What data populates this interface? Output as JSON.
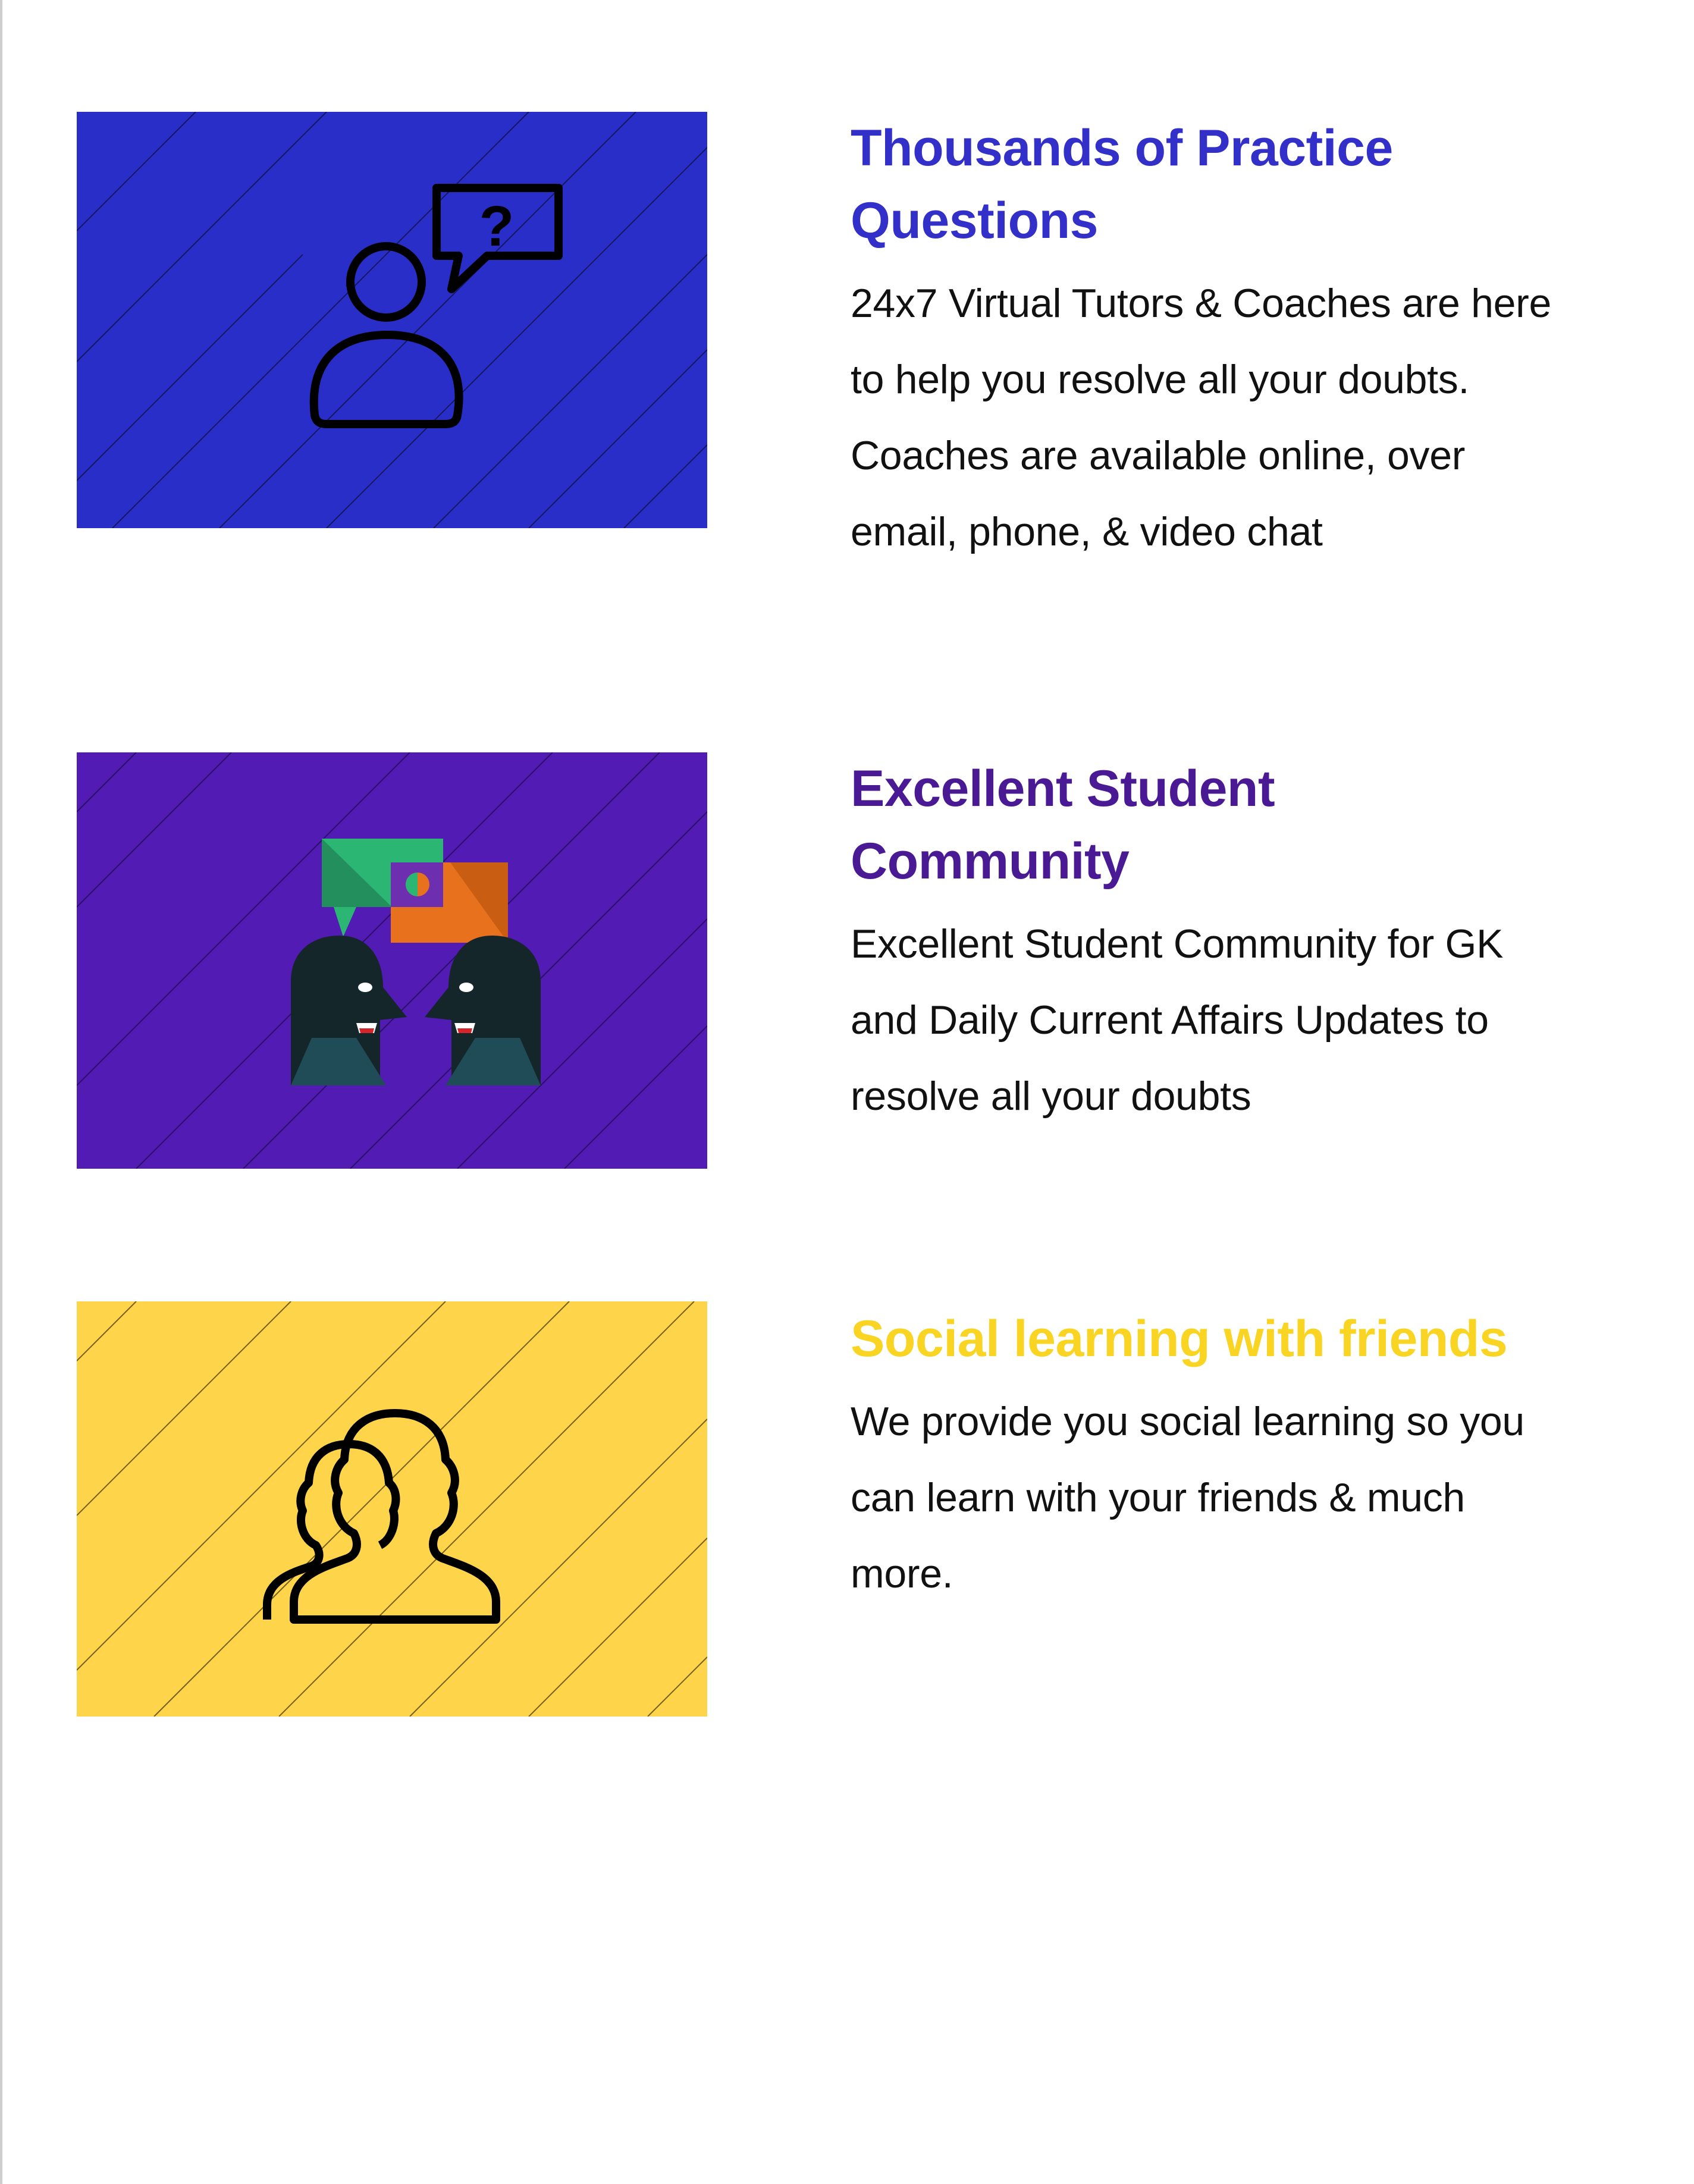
{
  "colors": {
    "blue_bg": "#2a2ec8",
    "purple_bg": "#521bb4",
    "yellow_bg": "#fed44a",
    "blue_title": "#3330c9",
    "purple_title": "#4a1a95",
    "yellow_title": "#f9d423",
    "green_bubble": "#2bb673",
    "orange_bubble": "#e8711e",
    "head_dark": "#14262a",
    "head_teal": "#1f4c57"
  },
  "features": [
    {
      "title": "Thousands of Practice Questions",
      "description": "24x7 Virtual Tutors & Coaches are here to help you resolve all your doubts. Coaches are available online, over email, phone, & video chat",
      "icon": "user-question-icon"
    },
    {
      "title": "Excellent Student Community",
      "description": "Excellent Student Community for GK and Daily Current Affairs Updates to resolve all your doubts",
      "icon": "community-chat-icon"
    },
    {
      "title": "Social learning with friends",
      "description": "We provide you social learning so you can learn with your friends & much more.",
      "icon": "friends-icon"
    }
  ]
}
